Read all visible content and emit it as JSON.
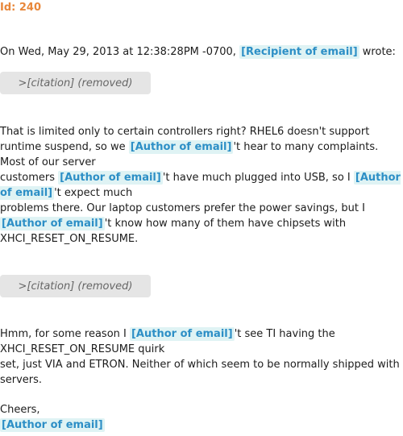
{
  "id_label": "Id: 240",
  "tags": {
    "recipient": "[Recipient of email]",
    "author": "[Author of email]"
  },
  "citation_text": ">[citation] (removed)",
  "header_line": {
    "prefix": "On Wed, May 29, 2013 at 12:38:28PM -0700, ",
    "suffix": " wrote:"
  },
  "paragraph1": {
    "s1": "That is limited only to certain controllers right? RHEL6 doesn't support runtime suspend, so we ",
    "s2": "'t hear to many complaints. Most of our server",
    "s3": "customers ",
    "s4": "'t have much plugged into USB, so I ",
    "s5": "'t expect much",
    "s6": "problems there. Our laptop customers prefer the power savings, but I ",
    "s7": "'t know how many of them have chipsets with",
    "s8": "XHCI_RESET_ON_RESUME."
  },
  "paragraph2": {
    "s1": "Hmm, for some reason I ",
    "s2": "'t see TI having the XHCI_RESET_ON_RESUME quirk",
    "s3": "set, just VIA and ETRON. Neither of which seem to be normally shipped with servers."
  },
  "signoff": "Cheers,"
}
